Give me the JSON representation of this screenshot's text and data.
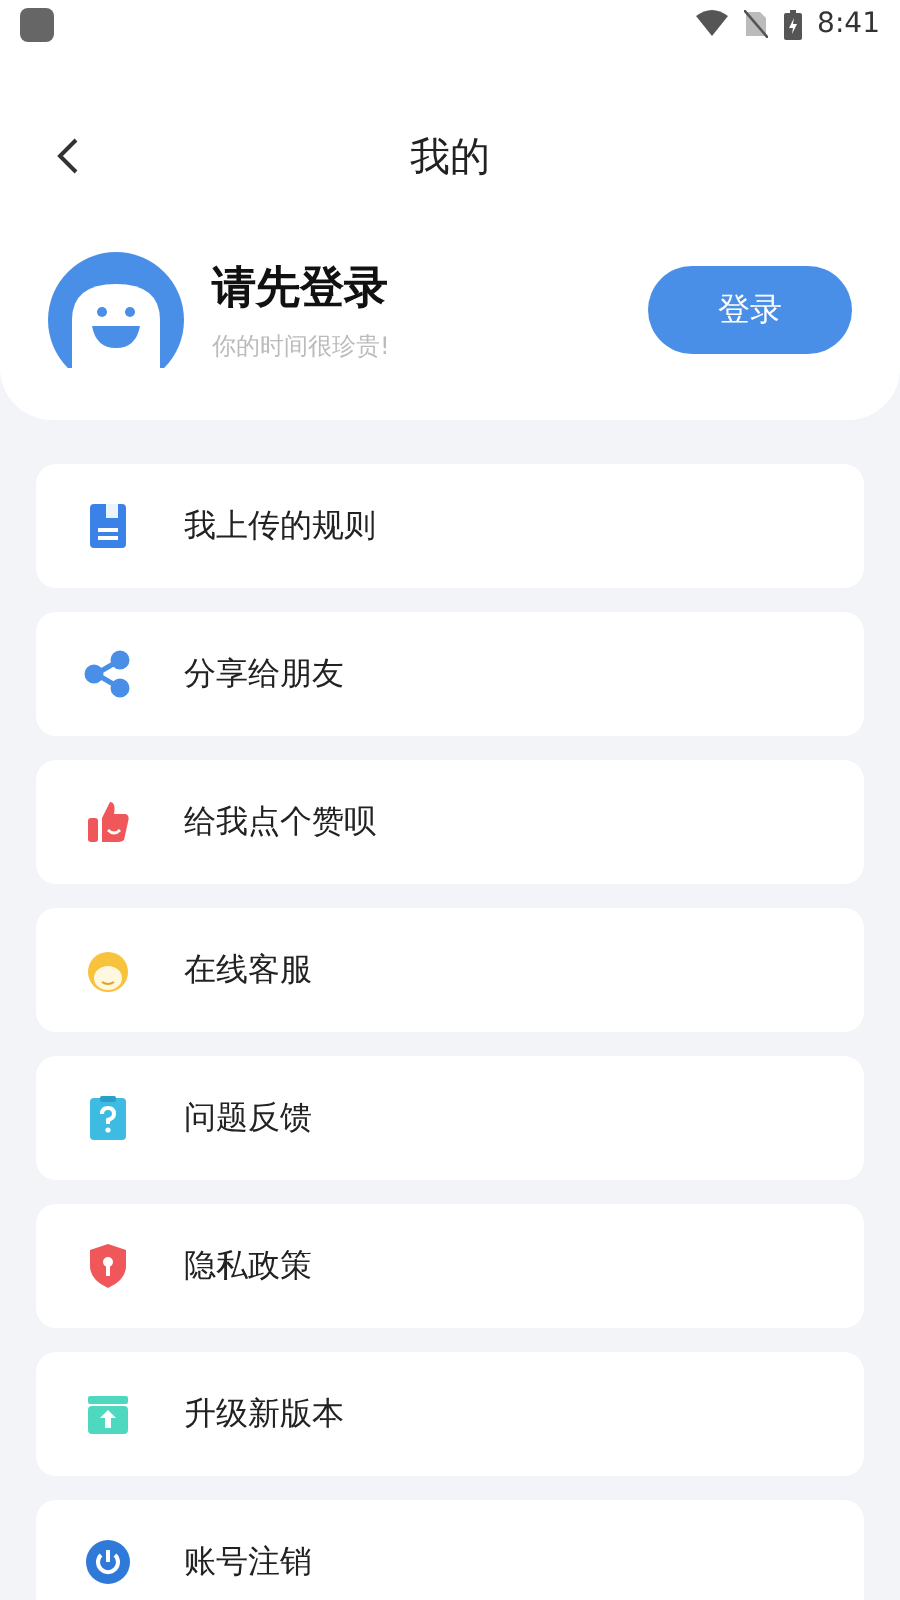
{
  "status_bar": {
    "time": "8:41"
  },
  "header": {
    "title": "我的"
  },
  "profile": {
    "name": "请先登录",
    "subtitle": "你的时间很珍贵!",
    "login_button": "登录"
  },
  "menu": [
    {
      "label": "我上传的规则",
      "kind": "document"
    },
    {
      "label": "分享给朋友",
      "kind": "share"
    },
    {
      "label": "给我点个赞呗",
      "kind": "thumb"
    },
    {
      "label": "在线客服",
      "kind": "agent"
    },
    {
      "label": "问题反馈",
      "kind": "feedback"
    },
    {
      "label": "隐私政策",
      "kind": "shield"
    },
    {
      "label": "升级新版本",
      "kind": "upgrade"
    },
    {
      "label": "账号注销",
      "kind": "power"
    }
  ]
}
